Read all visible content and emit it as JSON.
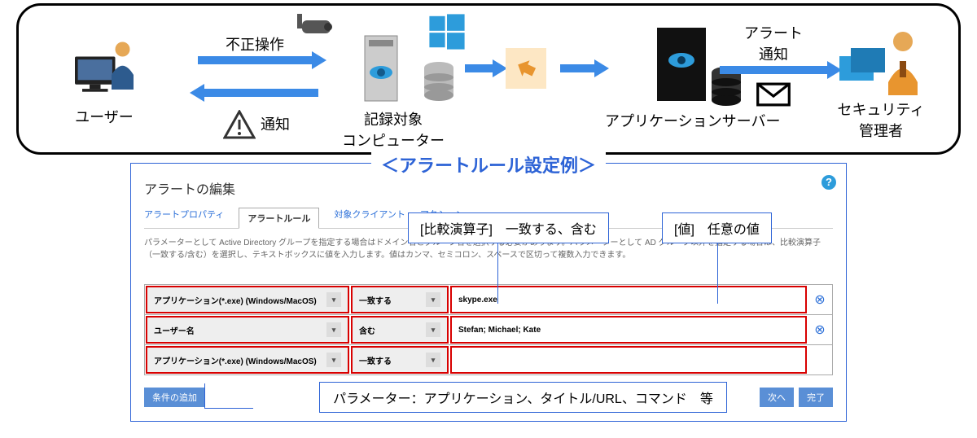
{
  "flow": {
    "user_label": "ユーザー",
    "target_label": "記録対象\nコンピューター",
    "appserver_label": "アプリケーションサーバー",
    "admin_label": "セキュリティ\n管理者",
    "arrow_unauthorized": "不正操作",
    "arrow_notify": "通知",
    "arrow_alert": "アラート\n通知"
  },
  "editor": {
    "section_title": "＜アラートルール設定例＞",
    "window_title": "アラートの編集",
    "tabs": {
      "properties": "アラートプロパティ",
      "rules": "アラートルール",
      "clients": "対象クライアント",
      "actions": "アクション"
    },
    "description": "パラメーターとして Active Directory グループを指定する場合はドメイン名とグループ名を選択する必要があります。パラメーターとして AD グループ以外を指定する場合は、比較演算子（一致する/含む）を選択し、テキストボックスに値を入力します。値はカンマ、セミコロン、スペースで区切って複数入力できます。",
    "callout_operator": "[比較演算子]　一致する、含む",
    "callout_value": "[値]　任意の値",
    "callout_param": "パラメーター：アプリケーション、タイトル/URL、コマンド　等",
    "rules": [
      {
        "param": "アプリケーション(*.exe) (Windows/MacOS)",
        "op": "一致する",
        "val": "skype.exe"
      },
      {
        "param": "ユーザー名",
        "op": "含む",
        "val": "Stefan; Michael; Kate"
      },
      {
        "param": "アプリケーション(*.exe) (Windows/MacOS)",
        "op": "一致する",
        "val": ""
      }
    ],
    "buttons": {
      "add": "条件の追加",
      "next": "次へ",
      "done": "完了"
    }
  }
}
